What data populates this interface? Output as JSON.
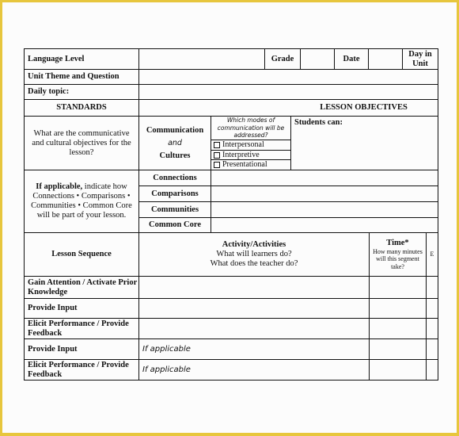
{
  "frame": {
    "border_color": "#e7c63d",
    "page_color": "#fcfcfc"
  },
  "header": {
    "language_level": "Language Level",
    "grade": "Grade",
    "date": "Date",
    "day_in_unit_1": "Day in",
    "day_in_unit_2": "Unit",
    "unit_theme": "Unit Theme and Question",
    "daily_topic": "Daily topic:"
  },
  "standards": {
    "title": "STANDARDS",
    "objectives_title": "LESSON OBJECTIVES",
    "question": "What are the communicative and cultural objectives for the lesson?",
    "comm_label_1": "Communication",
    "comm_label_and": "and",
    "comm_label_2": "Cultures",
    "modes_question": "Which modes of communication will be addressed?",
    "modes": [
      "Interpersonal",
      "Interpretive",
      "Presentational"
    ],
    "students_can": "Students can:",
    "if_applicable_bold": "If applicable,",
    "if_applicable_rest": " indicate how Connections • Comparisons • Communities • Common Core will be part of your lesson.",
    "other_standards": [
      "Connections",
      "Comparisons",
      "Communities",
      "Common Core"
    ]
  },
  "lesson": {
    "sequence_header": "Lesson Sequence",
    "activity_title": "Activity/Activities",
    "activity_q1": "What will learners do?",
    "activity_q2": "What does the teacher do?",
    "time_title": "Time*",
    "time_q": "How many minutes will this segment take?",
    "extra_col": "E",
    "rows": [
      {
        "step": "Gain Attention / Activate Prior Knowledge",
        "activity": ""
      },
      {
        "step": "Provide Input",
        "activity": ""
      },
      {
        "step": "Elicit Performance / Provide Feedback",
        "activity": ""
      },
      {
        "step": "Provide Input",
        "activity": "If applicable"
      },
      {
        "step": "Elicit Performance / Provide Feedback",
        "activity": "If applicable"
      }
    ]
  }
}
